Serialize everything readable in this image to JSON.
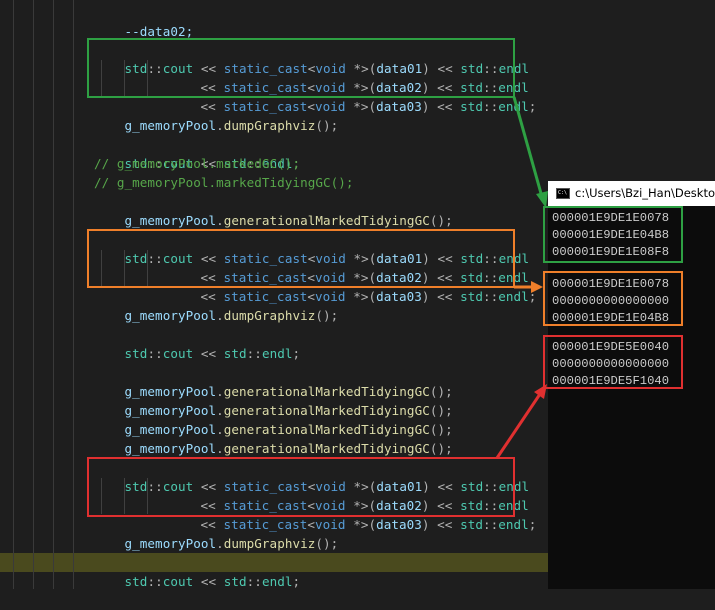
{
  "colors": {
    "green": "#2ea043",
    "orange": "#ef7f2a",
    "red": "#e03030",
    "highlight_line": "#4a4a1e"
  },
  "code": {
    "line_data02_dec": "--data02;",
    "cout1_l1": {
      "a": "std",
      "b": "::",
      "c": "cout",
      "d": " << ",
      "e": "static_cast",
      "f": "<",
      "g": "void",
      "h": " *>(",
      "i": "data01",
      "j": ") << ",
      "k": "std",
      "l": "::",
      "m": "endl"
    },
    "cout1_l2": {
      "d": "<< ",
      "e": "static_cast",
      "f": "<",
      "g": "void",
      "h": " *>(",
      "i": "data02",
      "j": ") << ",
      "k": "std",
      "l": "::",
      "m": "endl"
    },
    "cout1_l3": {
      "d": "<< ",
      "e": "static_cast",
      "f": "<",
      "g": "void",
      "h": " *>(",
      "i": "data03",
      "j": ") << ",
      "k": "std",
      "l": "::",
      "m": "endl",
      "n": ";"
    },
    "dump1": {
      "a": "g_memoryPool",
      "b": ".",
      "c": "dumpGraphviz",
      "d": "();"
    },
    "endl1": {
      "a": "std",
      "b": "::",
      "c": "cout",
      "d": " << ",
      "e": "std",
      "f": "::",
      "g": "endl",
      "h": ";"
    },
    "comment1": "// g_memoryPool.markedGC();",
    "comment2": "// g_memoryPool.markedTidyingGC();",
    "gen1": {
      "a": "g_memoryPool",
      "b": ".",
      "c": "generationalMarkedTidyingGC",
      "d": "();"
    },
    "cout2_l1": {
      "a": "std",
      "b": "::",
      "c": "cout",
      "d": " << ",
      "e": "static_cast",
      "f": "<",
      "g": "void",
      "h": " *>(",
      "i": "data01",
      "j": ") << ",
      "k": "std",
      "l": "::",
      "m": "endl"
    },
    "cout2_l2": {
      "d": "<< ",
      "e": "static_cast",
      "f": "<",
      "g": "void",
      "h": " *>(",
      "i": "data02",
      "j": ") << ",
      "k": "std",
      "l": "::",
      "m": "endl"
    },
    "cout2_l3": {
      "d": "<< ",
      "e": "static_cast",
      "f": "<",
      "g": "void",
      "h": " *>(",
      "i": "data03",
      "j": ") << ",
      "k": "std",
      "l": "::",
      "m": "endl",
      "n": ";"
    },
    "dump2": {
      "a": "g_memoryPool",
      "b": ".",
      "c": "dumpGraphviz",
      "d": "();"
    },
    "endl2": {
      "a": "std",
      "b": "::",
      "c": "cout",
      "d": " << ",
      "e": "std",
      "f": "::",
      "g": "endl",
      "h": ";"
    },
    "gen2": {
      "a": "g_memoryPool",
      "b": ".",
      "c": "generationalMarkedTidyingGC",
      "d": "();"
    },
    "gen3": {
      "a": "g_memoryPool",
      "b": ".",
      "c": "generationalMarkedTidyingGC",
      "d": "();"
    },
    "gen4": {
      "a": "g_memoryPool",
      "b": ".",
      "c": "generationalMarkedTidyingGC",
      "d": "();"
    },
    "gen5": {
      "a": "g_memoryPool",
      "b": ".",
      "c": "generationalMarkedTidyingGC",
      "d": "();"
    },
    "cout3_l1": {
      "a": "std",
      "b": "::",
      "c": "cout",
      "d": " << ",
      "e": "static_cast",
      "f": "<",
      "g": "void",
      "h": " *>(",
      "i": "data01",
      "j": ") << ",
      "k": "std",
      "l": "::",
      "m": "endl"
    },
    "cout3_l2": {
      "d": "<< ",
      "e": "static_cast",
      "f": "<",
      "g": "void",
      "h": " *>(",
      "i": "data02",
      "j": ") << ",
      "k": "std",
      "l": "::",
      "m": "endl"
    },
    "cout3_l3": {
      "d": "<< ",
      "e": "static_cast",
      "f": "<",
      "g": "void",
      "h": " *>(",
      "i": "data03",
      "j": ") << ",
      "k": "std",
      "l": "::",
      "m": "endl",
      "n": ";"
    },
    "dump3": {
      "a": "g_memoryPool",
      "b": ".",
      "c": "dumpGraphviz",
      "d": "();"
    },
    "endl3": {
      "a": "std",
      "b": "::",
      "c": "cout",
      "d": " << ",
      "e": "std",
      "f": "::",
      "g": "endl",
      "h": ";"
    }
  },
  "console": {
    "icon": "console-icon",
    "title": "c:\\Users\\Bzi_Han\\Desktop\\",
    "group1": [
      "000001E9DE1E0078",
      "000001E9DE1E04B8",
      "000001E9DE1E08F8"
    ],
    "group2": [
      "000001E9DE1E0078",
      "0000000000000000",
      "000001E9DE1E04B8"
    ],
    "group3": [
      "000001E9DE5E0040",
      "0000000000000000",
      "000001E9DE5F1040"
    ]
  }
}
